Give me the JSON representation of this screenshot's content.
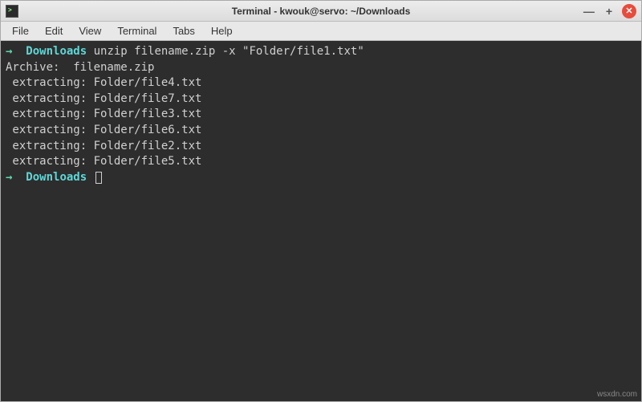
{
  "window": {
    "title": "Terminal - kwouk@servo: ~/Downloads"
  },
  "menubar": {
    "items": [
      "File",
      "Edit",
      "View",
      "Terminal",
      "Tabs",
      "Help"
    ]
  },
  "terminal": {
    "prompt_arrow": "→",
    "cwd": "Downloads",
    "command": "unzip filename.zip -x \"Folder/file1.txt\"",
    "output_lines": [
      "Archive:  filename.zip",
      " extracting: Folder/file4.txt        ",
      " extracting: Folder/file7.txt        ",
      " extracting: Folder/file3.txt        ",
      " extracting: Folder/file6.txt        ",
      " extracting: Folder/file2.txt        ",
      " extracting: Folder/file5.txt        "
    ]
  },
  "watermark": "wsxdn.com"
}
